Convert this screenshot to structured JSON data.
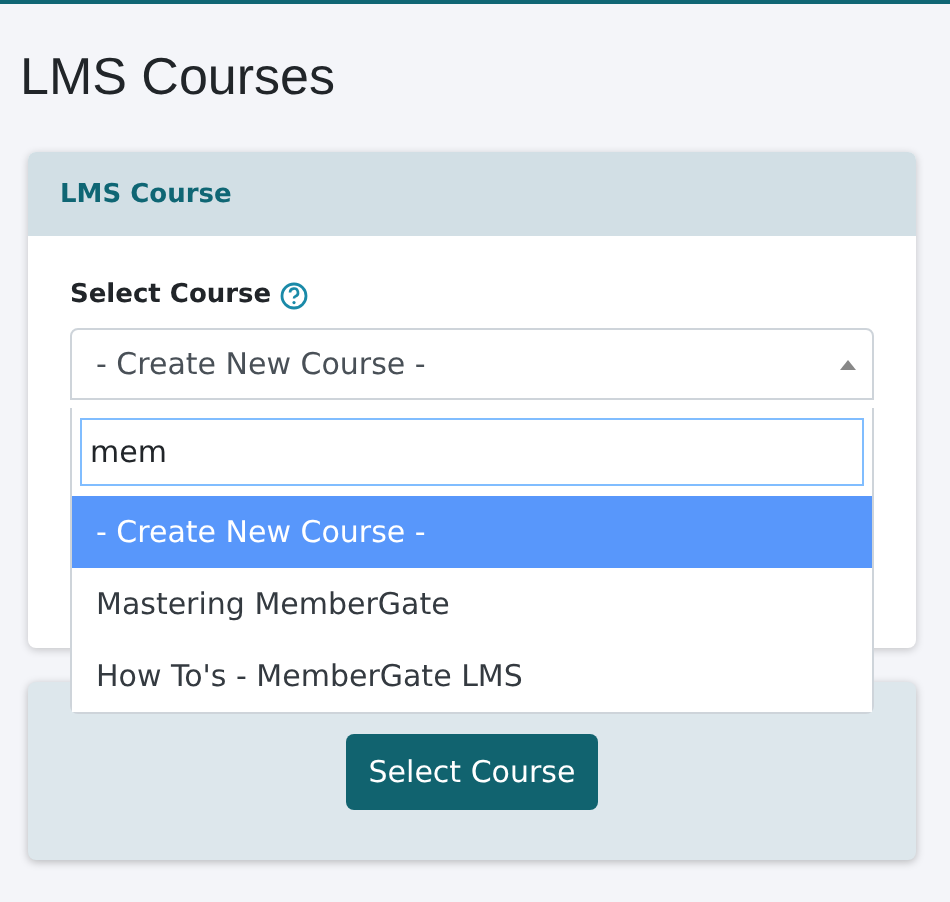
{
  "page_title": "LMS Courses",
  "card": {
    "header": "LMS Course",
    "field_label": "Select Course",
    "select": {
      "value": "- Create New Course -",
      "expanded": true
    },
    "dropdown": {
      "search": "mem",
      "options": [
        {
          "label": "- Create New Course -",
          "selected": true
        },
        {
          "label": "Mastering MemberGate",
          "selected": false
        },
        {
          "label": "How To's - MemberGate LMS",
          "selected": false
        }
      ]
    }
  },
  "footer": {
    "button": "Select Course"
  }
}
